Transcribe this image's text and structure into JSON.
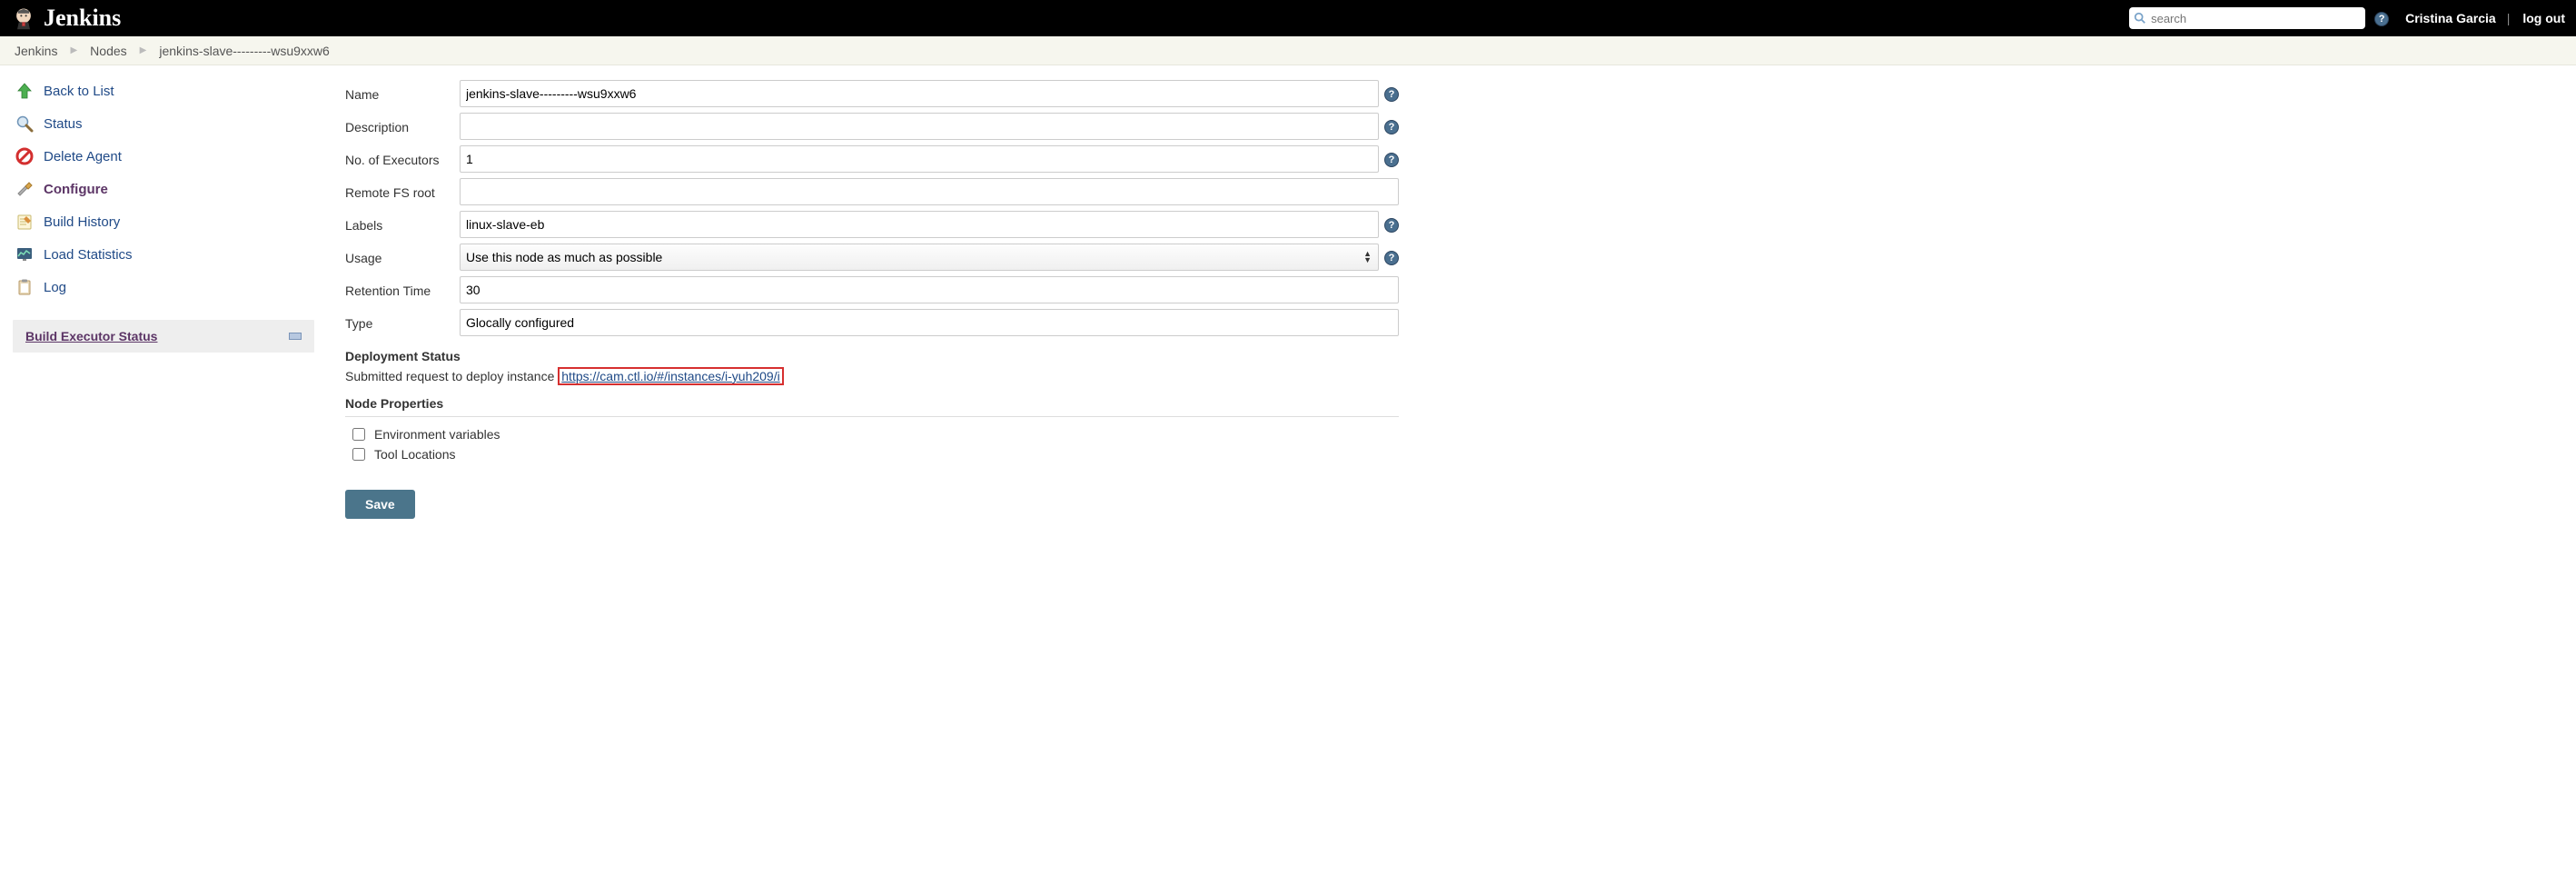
{
  "header": {
    "brand": "Jenkins",
    "search_placeholder": "search",
    "user": "Cristina Garcia",
    "logout": "log out"
  },
  "breadcrumbs": {
    "b0": "Jenkins",
    "b1": "Nodes",
    "b2": "jenkins-slave---------wsu9xxw6"
  },
  "sidebar": {
    "back": "Back to List",
    "status": "Status",
    "delete": "Delete Agent",
    "configure": "Configure",
    "build_history": "Build History",
    "load_stats": "Load Statistics",
    "log": "Log",
    "exec_status": "Build Executor Status"
  },
  "form": {
    "labels": {
      "name": "Name",
      "description": "Description",
      "executors": "No. of Executors",
      "remote_fs": "Remote FS root",
      "labels_field": "Labels",
      "usage": "Usage",
      "retention": "Retention Time",
      "type": "Type"
    },
    "values": {
      "name": "jenkins-slave---------wsu9xxw6",
      "description": "",
      "executors": "1",
      "remote_fs": "",
      "labels_field": "linux-slave-eb",
      "usage": "Use this node as much as possible",
      "retention": "30",
      "type": "Glocally configured"
    },
    "deployment_header": "Deployment Status",
    "deployment_text": "Submitted request to deploy instance",
    "deployment_link": "https://cam.ctl.io/#/instances/i-yuh209/i",
    "node_props_header": "Node Properties",
    "env_vars": "Environment variables",
    "tool_locations": "Tool Locations",
    "save": "Save"
  }
}
